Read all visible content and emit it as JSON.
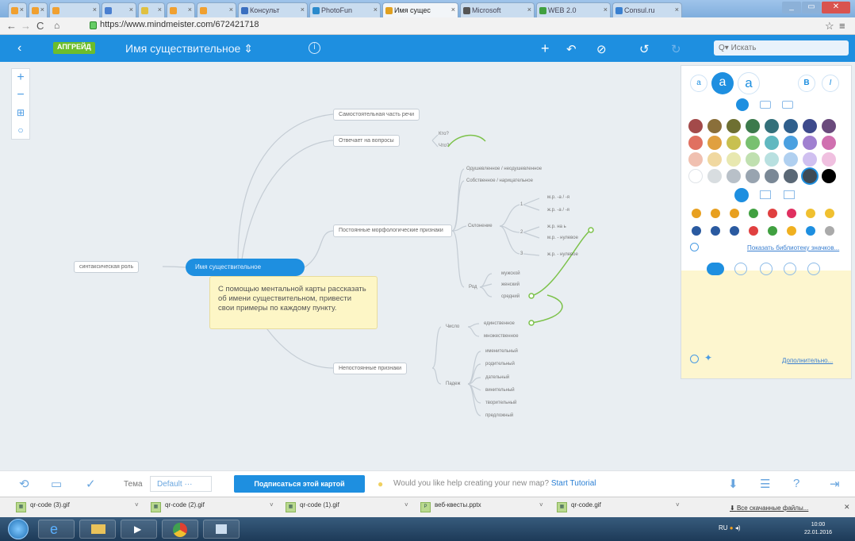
{
  "browser": {
    "tabs": [
      {
        "label": "",
        "color": "#f0a030"
      },
      {
        "label": "",
        "color": "#f0a030"
      },
      {
        "label": "",
        "color": "#f0a030"
      },
      {
        "label": "",
        "color": "#4a7fd0"
      },
      {
        "label": "",
        "color": "#e0c040"
      },
      {
        "label": "",
        "color": "#f0a030"
      },
      {
        "label": "",
        "color": "#f0a030"
      },
      {
        "label": "Консульт",
        "color": "#3a6fc0"
      },
      {
        "label": "PhotoFun",
        "color": "#2a8acc"
      },
      {
        "label": "Имя сущес",
        "color": "#e0a020",
        "active": true
      },
      {
        "label": "Microsoft",
        "color": "#555"
      },
      {
        "label": "WEB 2.0",
        "color": "#40a040"
      },
      {
        "label": "Consul.ru",
        "color": "#3a80d0"
      }
    ],
    "url": "https://www.mindmeister.com/672421718",
    "window_controls": [
      "_",
      "▭",
      "✕"
    ]
  },
  "toolbar": {
    "back_icon": "chevron-left-icon",
    "upgrade_label": "АПГРЕЙД",
    "map_title": "Имя существительное  ⇕",
    "info_label": "i",
    "search_placeholder": "Q▾ Искать",
    "icons": [
      "plus-icon",
      "connect-icon",
      "block-icon",
      "undo-icon",
      "redo-icon"
    ]
  },
  "canvas": {
    "zoom": [
      "+",
      "−",
      "⊞",
      "○"
    ],
    "root": "Имя существительное",
    "note": "С помощью ментальной карты рассказать об имени существительном, привести свои примеры по каждому пункту.",
    "left_node": "синтаксическая роль",
    "branches": {
      "b1": "Самостоятельная часть речи",
      "b2": "Отвечает на вопросы",
      "b2_kto": "Кто?",
      "b2_chto": "Что?",
      "b3": "Постоянные морфологические признаки",
      "b3_a": "Одушевленное / неодушевленное",
      "b3_b": "Собственное / нарицательное",
      "sklon": "Склонение",
      "sk1": "1",
      "sk1_a": "м.р. -а / -я",
      "sk1_b": "ж.р. -а / -я",
      "sk2": "2",
      "sk2_a": "ж.р. на ь",
      "sk2_b": "м.р. - нулевое",
      "sk3": "3",
      "sk3_a": "ж.р. - нулевое",
      "rod": "Род",
      "rod_a": "мужской",
      "rod_b": "женский",
      "rod_c": "средний",
      "b4": "Непостоянные признаки",
      "chislo": "Число",
      "ch_a": "единственное",
      "ch_b": "множественное",
      "padezh": "Падеж",
      "cases": [
        "именительный",
        "родительный",
        "дательный",
        "винительный",
        "творительный",
        "предложный"
      ]
    }
  },
  "panel": {
    "font_a_small": "a",
    "font_a_med": "a",
    "font_a_large": "a",
    "bold": "B",
    "italic": "I",
    "colors_row1": [
      "#a34a4a",
      "#8a6f3a",
      "#6e7032",
      "#3c7a4c",
      "#33707a",
      "#2f5f8c",
      "#3d4a8c",
      "#6a4a7c"
    ],
    "colors_row2": [
      "#e07060",
      "#e0a040",
      "#c8c050",
      "#78c070",
      "#60b8c0",
      "#4aa0e0",
      "#a080d0",
      "#d070b0"
    ],
    "colors_row3": [
      "#f0c0b0",
      "#f0d8a0",
      "#e8e8b0",
      "#c0e0b0",
      "#b8e0e0",
      "#b0d0f0",
      "#d0c0f0",
      "#f0c0e0"
    ],
    "colors_row4": [
      "#ffffff",
      "#d8dde0",
      "#b8c0c8",
      "#98a4b0",
      "#7a8896",
      "#5a6876",
      "#3e4a56",
      "#000000"
    ],
    "icon_link": "Показать библиотеку значков...",
    "more_link": "Дополнительно..."
  },
  "bottom": {
    "theme_label": "Тема",
    "theme_value": "Default  ···",
    "subscribe": "Подписаться этой картой",
    "help_text": "Would you like help creating your new map?",
    "help_link": "Start Tutorial"
  },
  "downloads": {
    "items": [
      "qr-code (3).gif",
      "qr-code (2).gif",
      "qr-code (1).gif",
      "веб-квесты.pptx",
      "qr-code.gif"
    ],
    "all_label": "Все скачанные файлы...",
    "close": "✕"
  },
  "taskbar": {
    "lang": "RU",
    "time": "10:00",
    "date": "22.01.2016"
  }
}
